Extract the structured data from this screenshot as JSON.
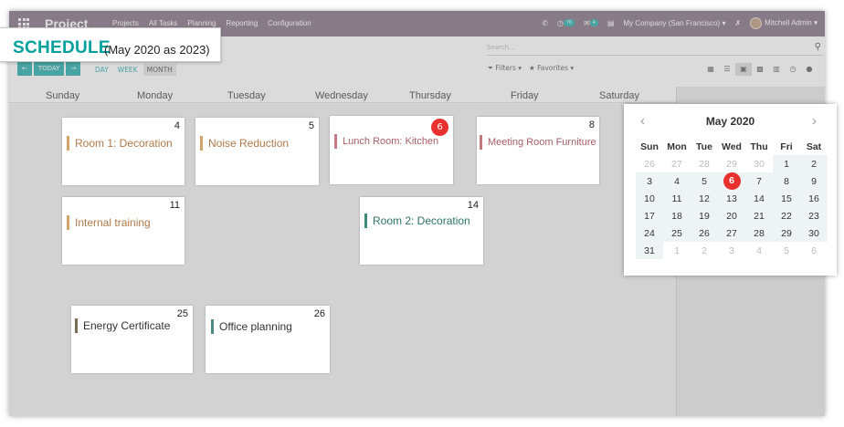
{
  "overlay": {
    "title": "SCHEDULE",
    "subtitle": "(May 2020 as 2023)"
  },
  "topbar": {
    "app_name": "Project",
    "menu": [
      "Projects",
      "All Tasks",
      "Planning",
      "Reporting",
      "Configuration"
    ],
    "activity_count": "76",
    "messages_count": "4",
    "company": "My Company (San Francisco)",
    "user": "Mitchell Admin"
  },
  "control_panel": {
    "search_placeholder": "Search...",
    "filters_label": "Filters",
    "favorites_label": "Favorites",
    "today_label": "TODAY",
    "scales": [
      "DAY",
      "WEEK",
      "MONTH"
    ],
    "active_scale": "MONTH"
  },
  "weekdays": [
    "Sunday",
    "Monday",
    "Tuesday",
    "Wednesday",
    "Thursday",
    "Friday",
    "Saturday"
  ],
  "events": [
    {
      "day": "4",
      "title": "Room 1: Decoration",
      "color": "#d1a36e",
      "text_color": "#b07a4a"
    },
    {
      "day": "5",
      "title": "Noise Reduction",
      "color": "#d1a36e",
      "text_color": "#b07a4a"
    },
    {
      "day": "6",
      "title": "Lunch Room: Kitchen",
      "color": "#c47a84",
      "text_color": "#a85d66",
      "today": true
    },
    {
      "day": "8",
      "title": "Meeting Room Furniture",
      "color": "#c47a84",
      "text_color": "#a85d66"
    },
    {
      "day": "11",
      "title": "Internal training",
      "color": "#d1a36e",
      "text_color": "#b07a4a"
    },
    {
      "day": "14",
      "title": "Room 2: Decoration",
      "color": "#3d8c7a",
      "text_color": "#2a7563"
    },
    {
      "day": "25",
      "title": "Energy Certificate",
      "color": "#7a6d55",
      "text_color": "#333333"
    },
    {
      "day": "26",
      "title": "Office planning",
      "color": "#4e8a83",
      "text_color": "#333333"
    }
  ],
  "mini_calendar": {
    "month": "May 2020",
    "weekday_abbr": [
      "Sun",
      "Mon",
      "Tue",
      "Wed",
      "Thu",
      "Fri",
      "Sat"
    ],
    "weeks": [
      [
        "26",
        "27",
        "28",
        "29",
        "30",
        "1",
        "2"
      ],
      [
        "3",
        "4",
        "5",
        "6",
        "7",
        "8",
        "9"
      ],
      [
        "10",
        "11",
        "12",
        "13",
        "14",
        "15",
        "16"
      ],
      [
        "17",
        "18",
        "19",
        "20",
        "21",
        "22",
        "23"
      ],
      [
        "24",
        "25",
        "26",
        "27",
        "28",
        "29",
        "30"
      ],
      [
        "31",
        "1",
        "2",
        "3",
        "4",
        "5",
        "6"
      ]
    ],
    "selected": "6"
  }
}
